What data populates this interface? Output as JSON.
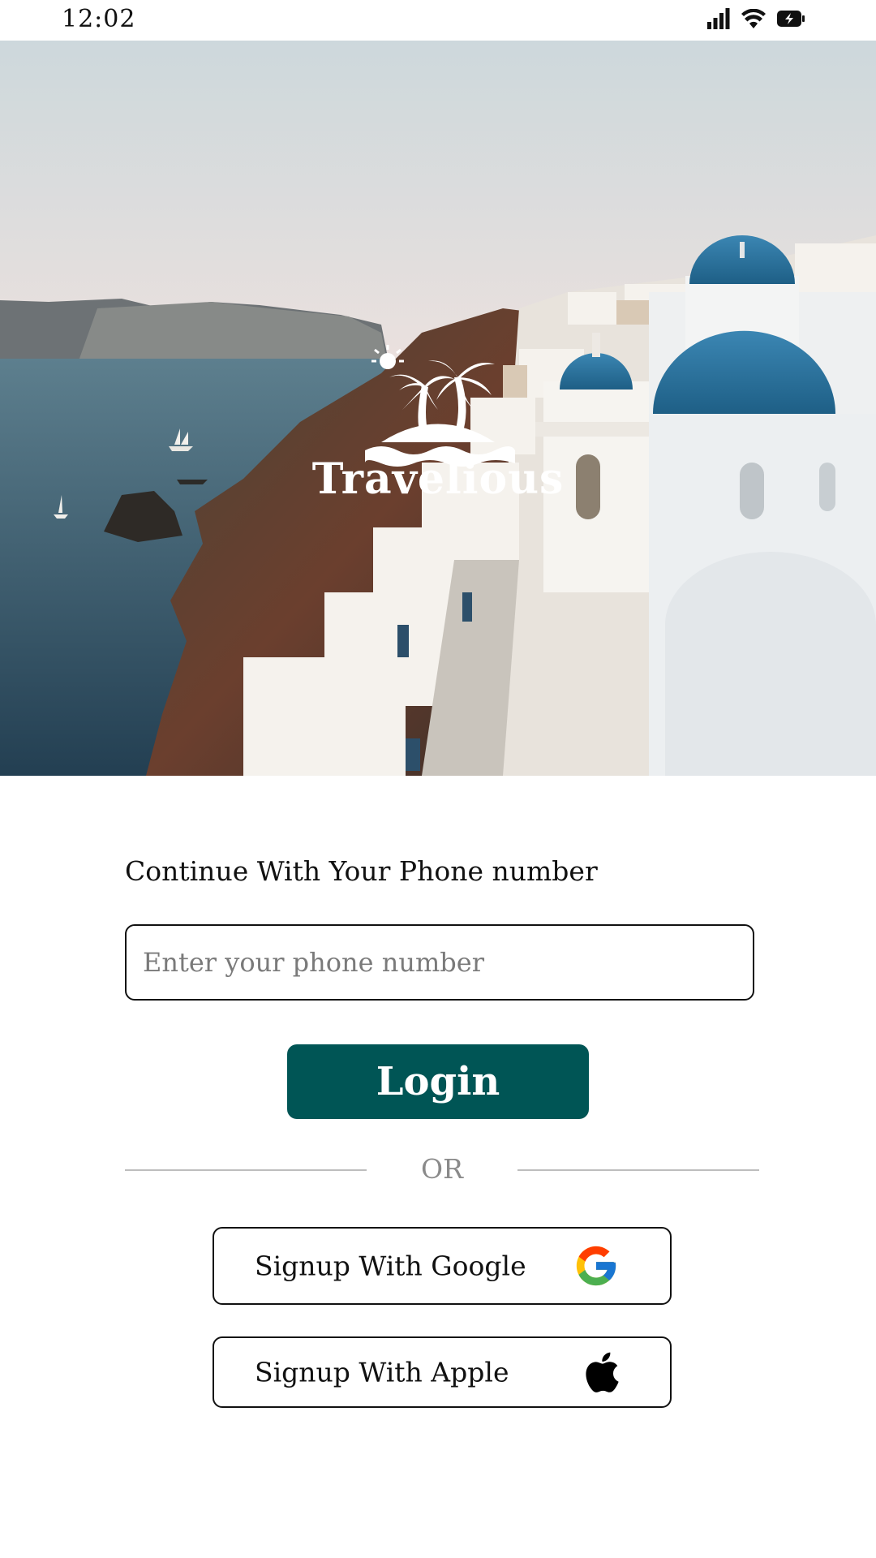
{
  "status_bar": {
    "time": "12:02",
    "icons": [
      "signal-icon",
      "wifi-icon",
      "battery-charging-icon"
    ]
  },
  "hero": {
    "image": "santorini-cliffside-photo",
    "logo_icon": "palm-island-sun-icon",
    "brand_name": "Travelious"
  },
  "form": {
    "prompt": "Continue With Your Phone number",
    "phone_placeholder": "Enter your phone number",
    "phone_value": "",
    "login_label": "Login",
    "divider_text": "OR"
  },
  "social": {
    "google_label": "Signup With Google",
    "google_icon": "google-icon",
    "apple_label": "Signup With Apple",
    "apple_icon": "apple-icon"
  },
  "colors": {
    "primary": "#005555",
    "background": "#ffffff",
    "placeholder": "#7a7a7a",
    "divider": "#bdbdbd"
  }
}
